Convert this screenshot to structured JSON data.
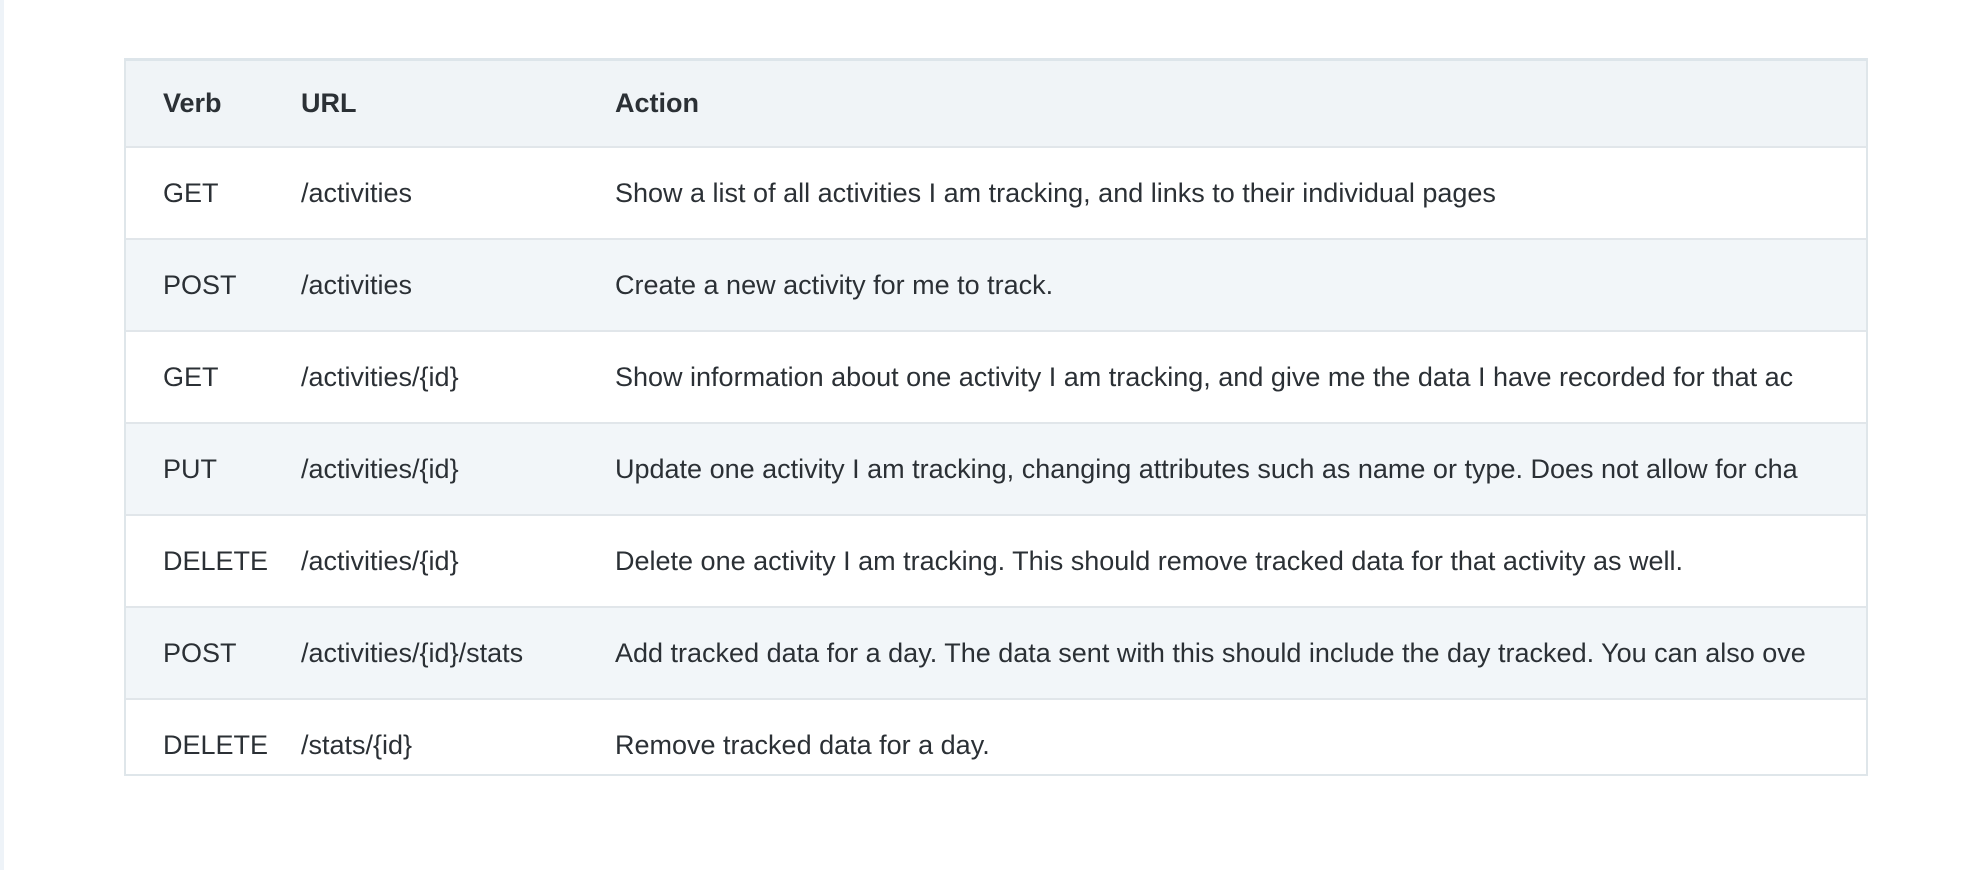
{
  "table": {
    "headers": {
      "verb": "Verb",
      "url": "URL",
      "action": "Action"
    },
    "rows": [
      {
        "verb": "GET",
        "url": "/activities",
        "action": "Show a list of all activities I am tracking, and links to their individual pages"
      },
      {
        "verb": "POST",
        "url": "/activities",
        "action": "Create a new activity for me to track."
      },
      {
        "verb": "GET",
        "url": "/activities/{id}",
        "action": "Show information about one activity I am tracking, and give me the data I have recorded for that ac"
      },
      {
        "verb": "PUT",
        "url": "/activities/{id}",
        "action": "Update one activity I am tracking, changing attributes such as name or type. Does not allow for cha"
      },
      {
        "verb": "DELETE",
        "url": "/activities/{id}",
        "action": "Delete one activity I am tracking. This should remove tracked data for that activity as well."
      },
      {
        "verb": "POST",
        "url": "/activities/{id}/stats",
        "action": "Add tracked data for a day. The data sent with this should include the day tracked. You can also ove"
      },
      {
        "verb": "DELETE",
        "url": "/stats/{id}",
        "action": "Remove tracked data for a day."
      }
    ]
  }
}
